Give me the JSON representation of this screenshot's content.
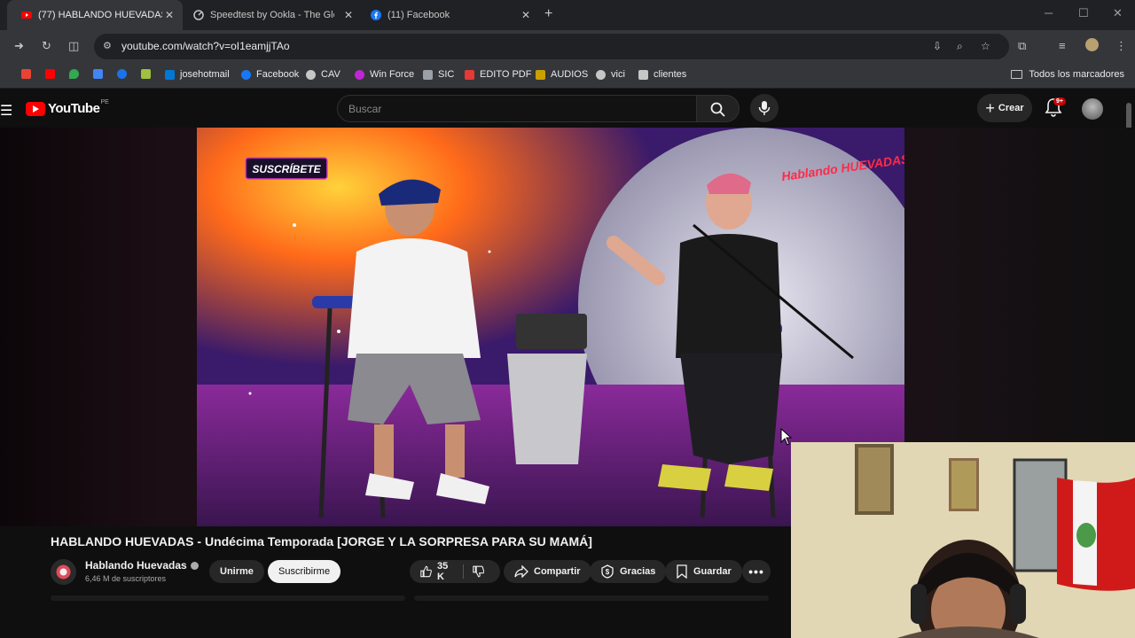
{
  "browser": {
    "tabs": [
      {
        "title": "(77) HABLANDO HUEVADAS - Un",
        "active": true,
        "icon": "youtube-icon"
      },
      {
        "title": "Speedtest by Ookla - The Glob",
        "active": false,
        "icon": "speedtest-icon"
      },
      {
        "title": "(11) Facebook",
        "active": false,
        "icon": "facebook-icon"
      }
    ],
    "url": "youtube.com/watch?v=oI1eamjjTAo",
    "bookmarks": [
      {
        "label": "",
        "color": "#ea4335"
      },
      {
        "label": "",
        "color": "#ff0000"
      },
      {
        "label": "",
        "color": "#34a853"
      },
      {
        "label": "",
        "color": "#4285f4"
      },
      {
        "label": "",
        "color": "#1a73e8"
      },
      {
        "label": "",
        "color": "#a0c040"
      },
      {
        "label": "josehotmail",
        "color": "#0078d4"
      },
      {
        "label": "Facebook",
        "color": "#1877f2"
      },
      {
        "label": "CAV",
        "color": "#c4c7c5"
      },
      {
        "label": "Win Force",
        "color": "#c026d3"
      },
      {
        "label": "SIC",
        "color": "#9aa0a6"
      },
      {
        "label": "EDITO PDF",
        "color": "#e53935"
      },
      {
        "label": "AUDIOS",
        "color": "#c8a000"
      },
      {
        "label": "vici",
        "color": "#c4c7c5"
      },
      {
        "label": "clientes",
        "color": "#c4c7c5"
      }
    ],
    "all_bookmarks": "Todos los marcadores"
  },
  "youtube": {
    "logo_text": "YouTube",
    "country": "PE",
    "search_placeholder": "Buscar",
    "create_label": "Crear",
    "notifications": "9+",
    "video_title": "HABLANDO HUEVADAS - Undécima Temporada [JORGE Y LA SORPRESA PARA SU MAMÁ]",
    "overlay_subscribe": "SUSCRÍBETE",
    "overlay_brand": "Hablando HUEVADAS",
    "channel_name": "Hablando Huevadas",
    "subscribers": "6,46 M de suscriptores",
    "join_label": "Unirme",
    "subscribe_label": "Suscribirme",
    "likes": "35 K",
    "share_label": "Compartir",
    "thanks_label": "Gracias",
    "save_label": "Guardar"
  }
}
